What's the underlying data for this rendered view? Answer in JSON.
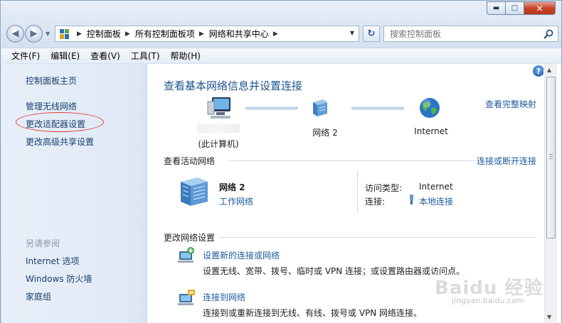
{
  "window": {
    "controls": {
      "minimize": "▬",
      "maximize": "□",
      "close": "✕"
    }
  },
  "nav": {
    "back_icon": "back-arrow-icon",
    "forward_icon": "forward-arrow-icon",
    "breadcrumb": [
      "控制面板",
      "所有控制面板项",
      "网络和共享中心"
    ],
    "search_placeholder": "搜索控制面板"
  },
  "menubar": {
    "items": [
      "文件(F)",
      "编辑(E)",
      "查看(V)",
      "工具(T)",
      "帮助(H)"
    ]
  },
  "sidebar": {
    "home": "控制面板主页",
    "items": [
      "管理无线网络",
      "更改适配器设置",
      "更改高级共享设置"
    ],
    "see_also_title": "另请参阅",
    "see_also": [
      "Internet 选项",
      "Windows 防火墙",
      "家庭组"
    ]
  },
  "main": {
    "title": "查看基本网络信息并设置连接",
    "full_map_link": "查看完整映射",
    "map": {
      "computer_label": "(此计算机)",
      "network_label": "网络  2",
      "internet_label": "Internet"
    },
    "active_section_title": "查看活动网络",
    "connect_disconnect_link": "连接或断开连接",
    "active_network": {
      "name": "网络  2",
      "type_link": "工作网络",
      "access_type_label": "访问类型:",
      "access_type_value": "Internet",
      "connection_label": "连接:",
      "connection_value": "本地连接"
    },
    "change_section_title": "更改网络设置",
    "tasks": [
      {
        "title": "设置新的连接或网络",
        "desc": "设置无线、宽带、拨号、临时或 VPN 连接；或设置路由器或访问点。"
      },
      {
        "title": "连接到网络",
        "desc": "连接到或重新连接到无线、有线、拨号或 VPN 网络连接。"
      }
    ]
  },
  "watermark": {
    "brand": "Baidu 经验",
    "url": "jingyan.baidu.com"
  },
  "colors": {
    "link": "#1d5a9c",
    "title": "#1d5290",
    "sidebar_bg": "#e3ecf7",
    "annotation_circle": "#e23b3b"
  }
}
